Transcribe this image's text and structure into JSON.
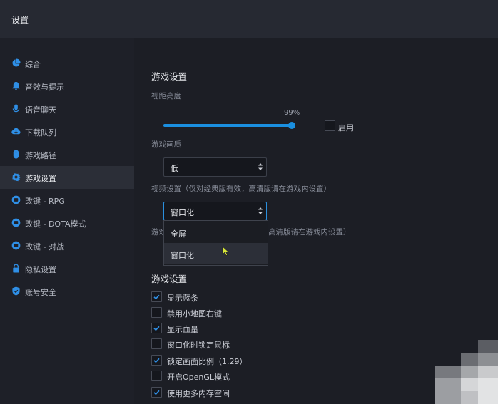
{
  "window": {
    "title": "设置"
  },
  "sidebar": {
    "items": [
      {
        "label": "综合",
        "icon": "pie-chart-icon"
      },
      {
        "label": "音效与提示",
        "icon": "bell-icon"
      },
      {
        "label": "语音聊天",
        "icon": "microphone-icon"
      },
      {
        "label": "下载队列",
        "icon": "cloud-download-icon"
      },
      {
        "label": "游戏路径",
        "icon": "mouse-icon"
      },
      {
        "label": "游戏设置",
        "icon": "gear-icon",
        "active": true
      },
      {
        "label": "改键 - RPG",
        "icon": "keyboard-icon"
      },
      {
        "label": "改键 - DOTA模式",
        "icon": "keyboard-icon"
      },
      {
        "label": "改键 - 对战",
        "icon": "keyboard-icon"
      },
      {
        "label": "隐私设置",
        "icon": "lock-icon"
      },
      {
        "label": "账号安全",
        "icon": "shield-icon"
      }
    ]
  },
  "main": {
    "section1_title": "游戏设置",
    "brightness": {
      "label": "视距亮度",
      "value_text": "99%",
      "value": 0.99,
      "enable_label": "启用",
      "enabled": false
    },
    "quality": {
      "label": "游戏画质",
      "selected": "低"
    },
    "video": {
      "label": "视频设置（仅对经典版有效，高清版请在游戏内设置）",
      "selected": "窗口化"
    },
    "hidden_label": {
      "prefix": "游戏",
      "suffix": "高清版请在游戏内设置）"
    },
    "dropdown": {
      "options": [
        "全屏",
        "窗口化"
      ],
      "hovered": "窗口化"
    },
    "section2_title": "游戏设置",
    "checkboxes": [
      {
        "label": "显示蓝条",
        "checked": true
      },
      {
        "label": "禁用小地图右键",
        "checked": false
      },
      {
        "label": "显示血量",
        "checked": true
      },
      {
        "label": "窗口化时锁定鼠标",
        "checked": false
      },
      {
        "label": "锁定画面比例（1.29）",
        "checked": true
      },
      {
        "label": "开启OpenGL模式",
        "checked": false
      },
      {
        "label": "使用更多内存空间",
        "checked": true
      }
    ]
  },
  "colors": {
    "accent": "#1a8fe0"
  }
}
